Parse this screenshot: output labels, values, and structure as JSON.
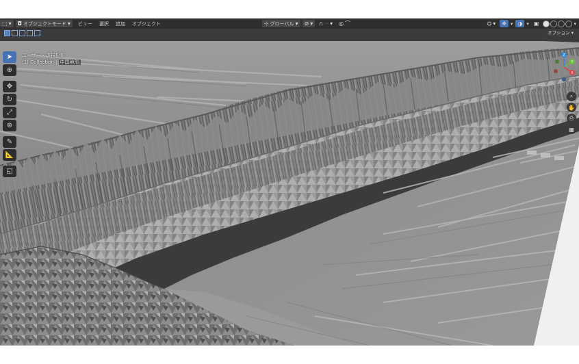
{
  "header": {
    "mode_label": "オブジェクトモード",
    "menus": [
      "ビュー",
      "選択",
      "追加",
      "オブジェクト"
    ],
    "transform_label": "グローバル"
  },
  "subbar": {
    "options_label": "オプション"
  },
  "overlay": {
    "view_label": "ユーザー・透視投影",
    "collection_label": "(1) Collection",
    "object_label": "中国地形"
  },
  "toolbar": {
    "tools": [
      "select-box",
      "cursor",
      "move",
      "rotate",
      "scale",
      "transform",
      "annotate",
      "measure",
      "add-cube"
    ]
  },
  "gizmo": {
    "axes": [
      "X",
      "Y",
      "Z"
    ]
  },
  "colors": {
    "accent": "#4772b3",
    "header_bg": "#2f2f2f",
    "mesh": "#8f8f8f"
  }
}
